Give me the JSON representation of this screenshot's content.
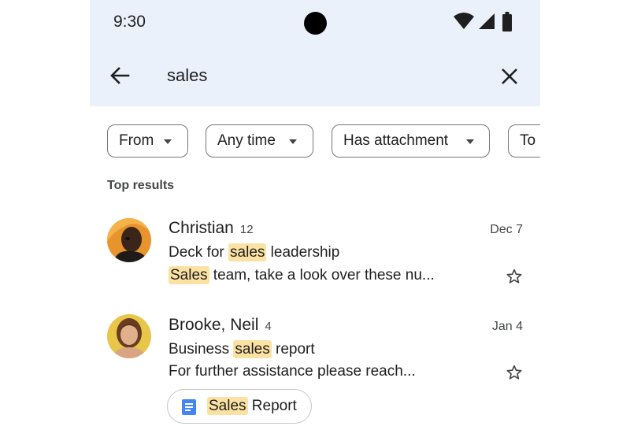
{
  "status_bar": {
    "time": "9:30"
  },
  "search": {
    "query": "sales"
  },
  "filters": [
    {
      "label": "From"
    },
    {
      "label": "Any time"
    },
    {
      "label": "Has attachment"
    },
    {
      "label": "To"
    }
  ],
  "section_title": "Top results",
  "results": [
    {
      "sender": "Christian",
      "count": "12",
      "date": "Dec 7",
      "subject_pre": "Deck for ",
      "subject_hl": "sales",
      "subject_post": " leadership",
      "snippet_hl": "Sales",
      "snippet_post": " team, take a look over these nu...",
      "starred": false
    },
    {
      "sender": "Brooke, Neil",
      "count": "4",
      "date": "Jan 4",
      "subject_pre": "Business ",
      "subject_hl": "sales",
      "subject_post": " report",
      "snippet": "For further assistance please reach...",
      "starred": false,
      "attachment": {
        "name_hl": "Sales",
        "name_post": " Report",
        "icon": "google-docs-icon"
      }
    }
  ],
  "colors": {
    "highlight": "#fbe2a3",
    "header_bg": "#eaf1fb",
    "doc_icon": "#4285f4"
  }
}
